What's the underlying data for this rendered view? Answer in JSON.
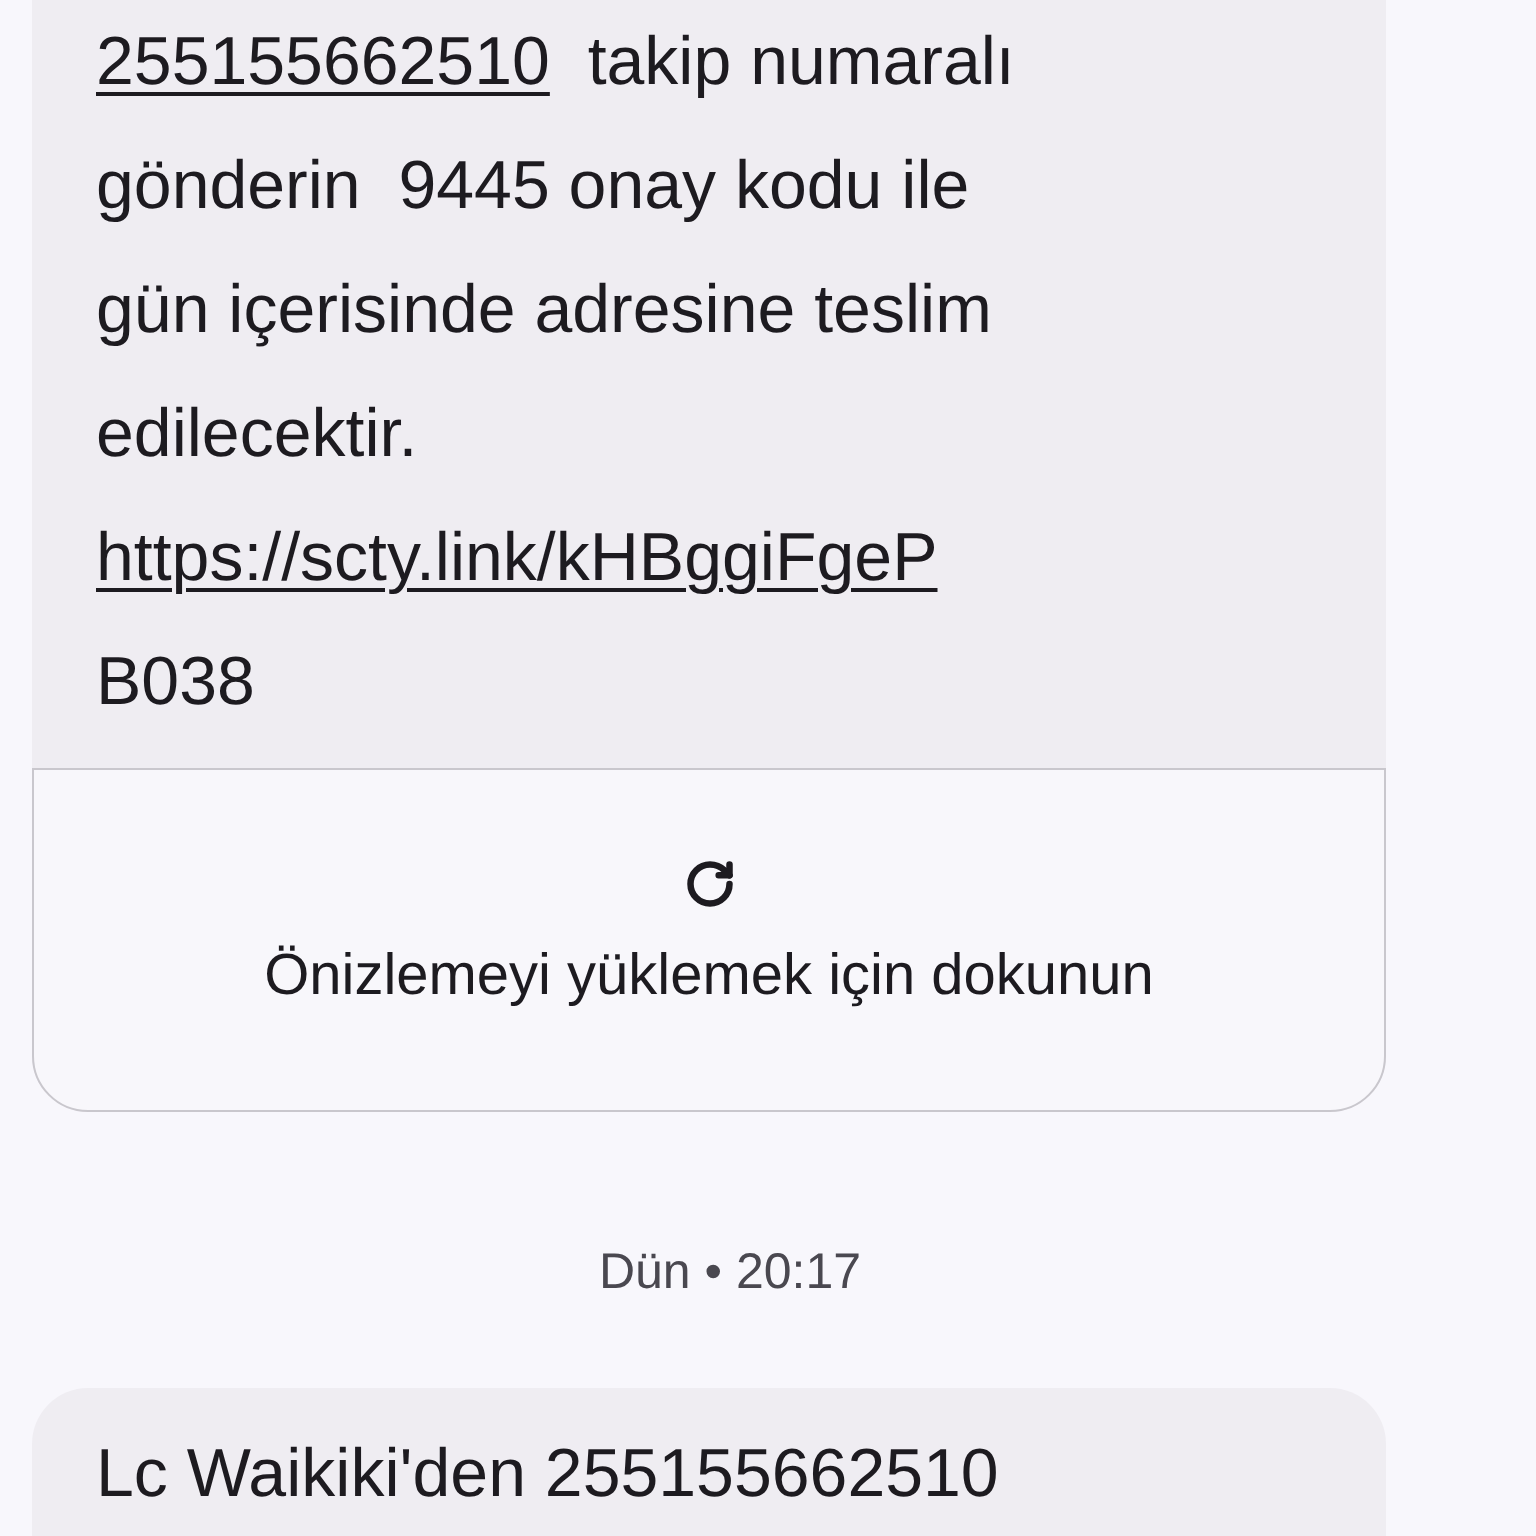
{
  "messages": [
    {
      "kind": "message",
      "lines": [
        [
          {
            "kind": "link",
            "text": "255155662510"
          },
          {
            "kind": "text",
            "text": "  takip numaralı"
          }
        ],
        [
          {
            "kind": "text",
            "text": "gönderin  9445 onay kodu ile"
          }
        ],
        [
          {
            "kind": "text",
            "text": "gün içerisinde adresine teslim"
          }
        ],
        [
          {
            "kind": "text",
            "text": "edilecektir."
          }
        ],
        [
          {
            "kind": "link",
            "text": "https://scty.link/kHBggiFgeP"
          }
        ],
        [
          {
            "kind": "text",
            "text": "B038"
          }
        ]
      ],
      "preview": {
        "label": "Önizlemeyi yüklemek için dokunun"
      }
    },
    {
      "kind": "timestamp",
      "text": "Dün • 20:17"
    },
    {
      "kind": "message",
      "lines": [
        [
          {
            "kind": "text",
            "text": "Lc Waikiki'den 255155662510"
          }
        ]
      ]
    }
  ]
}
